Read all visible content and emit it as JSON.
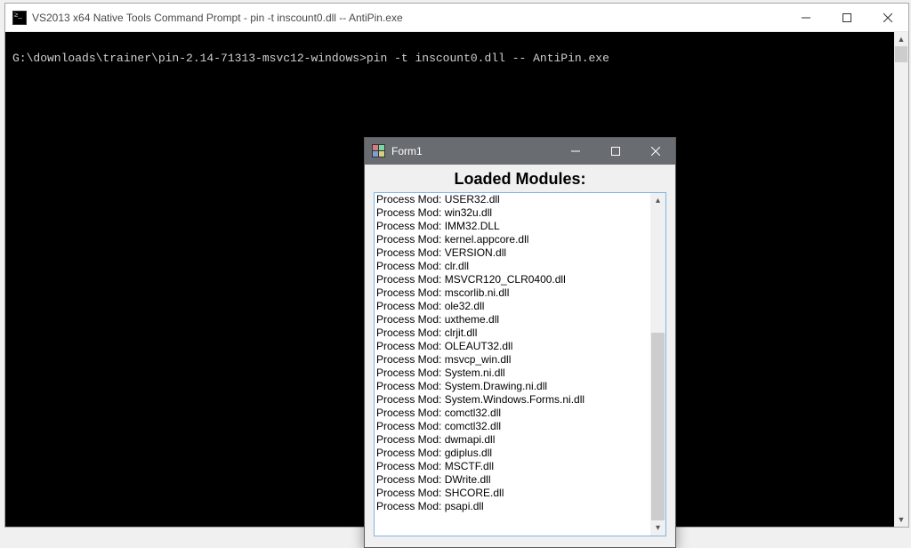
{
  "cmd": {
    "title": "VS2013 x64 Native Tools Command Prompt - pin  -t inscount0.dll -- AntiPin.exe",
    "prompt_line": "G:\\downloads\\trainer\\pin-2.14-71313-msvc12-windows>pin -t inscount0.dll -- AntiPin.exe"
  },
  "form": {
    "title": "Form1",
    "heading": "Loaded Modules:",
    "items": [
      "Process Mod: USER32.dll",
      "Process Mod: win32u.dll",
      "Process Mod: IMM32.DLL",
      "Process Mod: kernel.appcore.dll",
      "Process Mod: VERSION.dll",
      "Process Mod: clr.dll",
      "Process Mod: MSVCR120_CLR0400.dll",
      "Process Mod: mscorlib.ni.dll",
      "Process Mod: ole32.dll",
      "Process Mod: uxtheme.dll",
      "Process Mod: clrjit.dll",
      "Process Mod: OLEAUT32.dll",
      "Process Mod: msvcp_win.dll",
      "Process Mod: System.ni.dll",
      "Process Mod: System.Drawing.ni.dll",
      "Process Mod: System.Windows.Forms.ni.dll",
      "Process Mod: comctl32.dll",
      "Process Mod: comctl32.dll",
      "Process Mod: dwmapi.dll",
      "Process Mod: gdiplus.dll",
      "Process Mod: MSCTF.dll",
      "Process Mod: DWrite.dll",
      "Process Mod: SHCORE.dll",
      "Process Mod: psapi.dll"
    ]
  }
}
